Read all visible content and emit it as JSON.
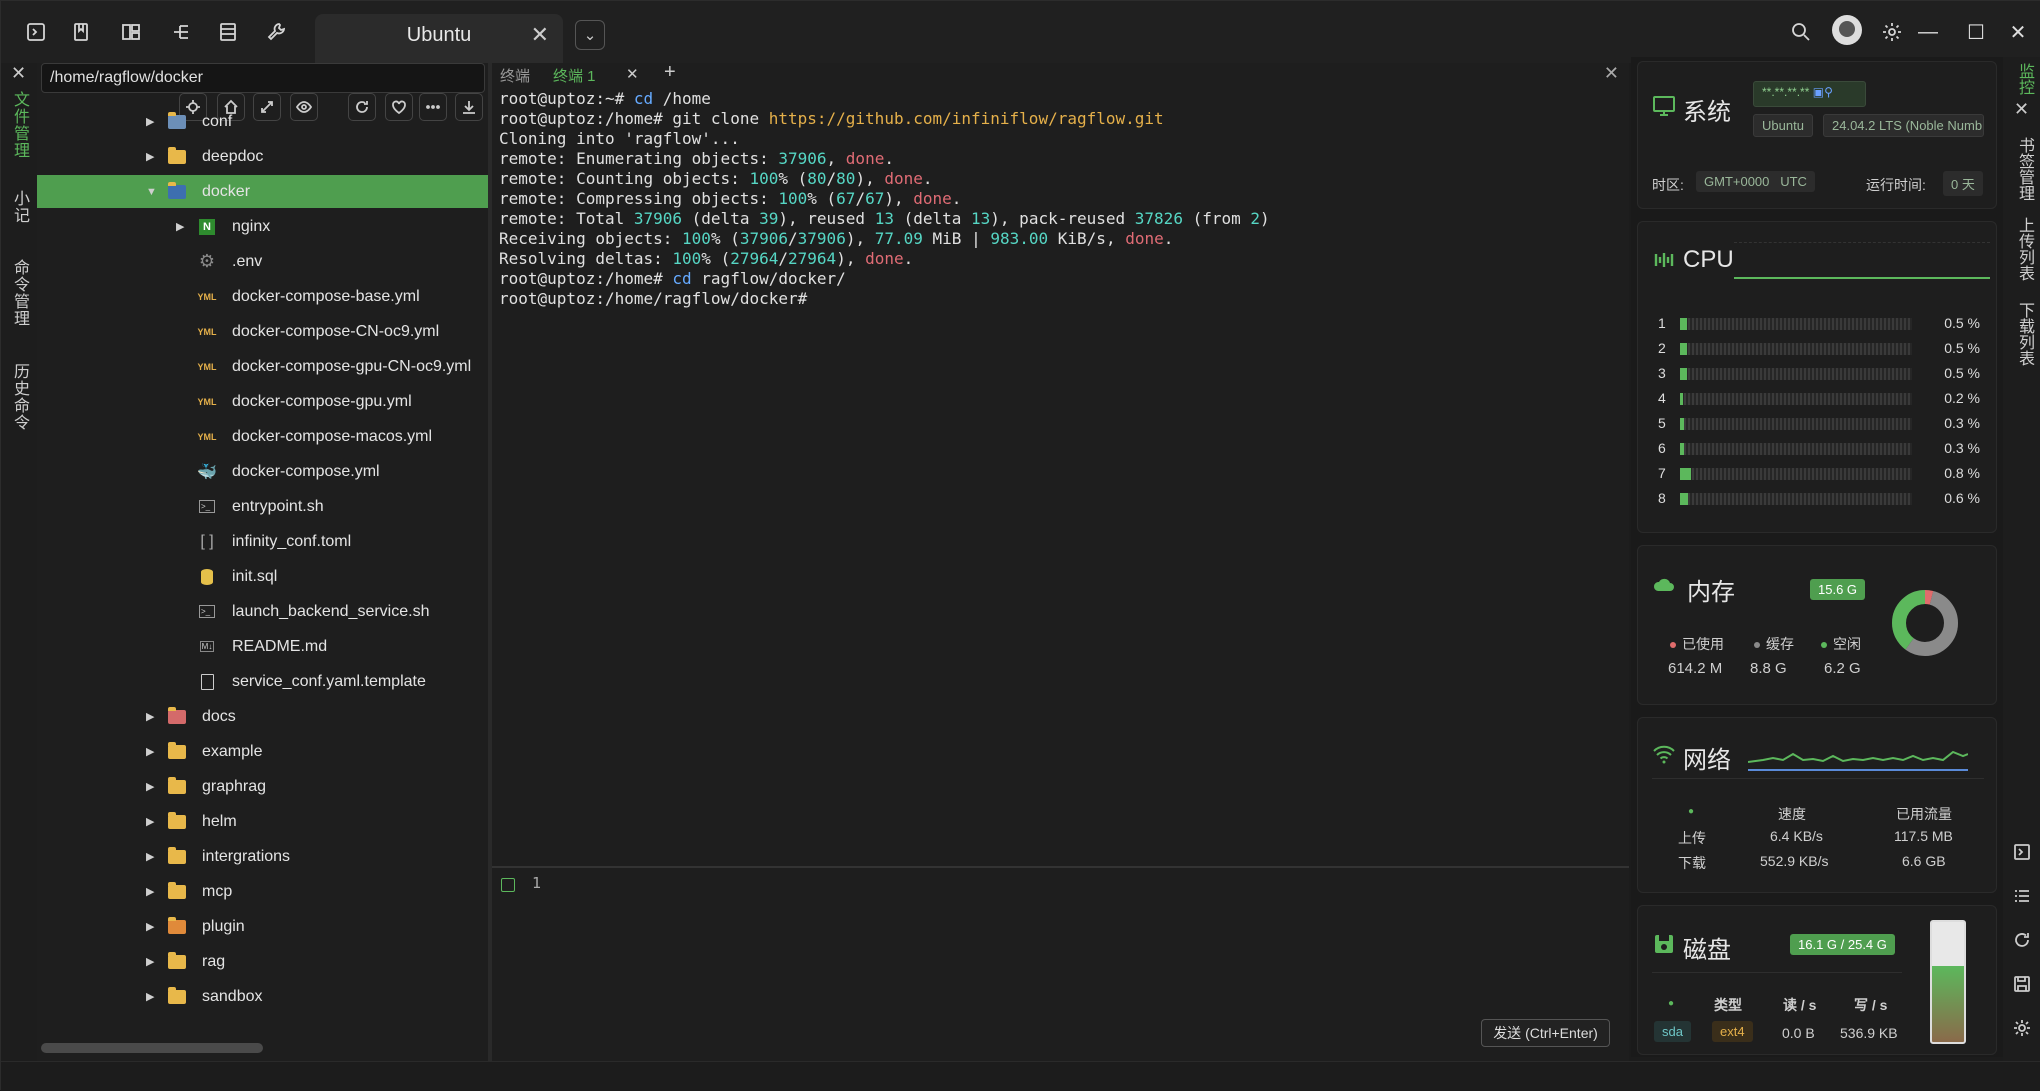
{
  "colors": {
    "accent": "#5cb85c",
    "selection": "#4f9e4f",
    "background": "#1e1e1e"
  },
  "titlebar": {
    "tab_title": "Ubuntu",
    "tab_close": "✕",
    "dropdown_glyph": "⌄",
    "min": "—",
    "max": "☐",
    "close": "✕"
  },
  "leftbar": {
    "close": "✕",
    "tabs": [
      "文件管理",
      "小记",
      "命令管理",
      "历史命令"
    ]
  },
  "filepanel": {
    "path": "/home/ragflow/docker",
    "tree": [
      {
        "label": "conf",
        "type": "folder-special",
        "expandable": true,
        "indent": 1
      },
      {
        "label": "deepdoc",
        "type": "folder",
        "expandable": true,
        "indent": 1
      },
      {
        "label": "docker",
        "type": "folder-open",
        "expandable": true,
        "expanded": true,
        "indent": 1,
        "selected": true
      },
      {
        "label": "nginx",
        "type": "nginx",
        "expandable": true,
        "indent": 2
      },
      {
        "label": ".env",
        "type": "gear",
        "indent": 2
      },
      {
        "label": "docker-compose-base.yml",
        "type": "yml",
        "indent": 2
      },
      {
        "label": "docker-compose-CN-oc9.yml",
        "type": "yml",
        "indent": 2
      },
      {
        "label": "docker-compose-gpu-CN-oc9.yml",
        "type": "yml",
        "indent": 2
      },
      {
        "label": "docker-compose-gpu.yml",
        "type": "yml",
        "indent": 2
      },
      {
        "label": "docker-compose-macos.yml",
        "type": "yml",
        "indent": 2
      },
      {
        "label": "docker-compose.yml",
        "type": "docker",
        "indent": 2
      },
      {
        "label": "entrypoint.sh",
        "type": "sh",
        "indent": 2
      },
      {
        "label": "infinity_conf.toml",
        "type": "toml",
        "indent": 2
      },
      {
        "label": "init.sql",
        "type": "sql",
        "indent": 2
      },
      {
        "label": "launch_backend_service.sh",
        "type": "sh",
        "indent": 2
      },
      {
        "label": "README.md",
        "type": "md",
        "indent": 2
      },
      {
        "label": "service_conf.yaml.template",
        "type": "file",
        "indent": 2
      },
      {
        "label": "docs",
        "type": "folder-red",
        "expandable": true,
        "indent": 1
      },
      {
        "label": "example",
        "type": "folder",
        "expandable": true,
        "indent": 1
      },
      {
        "label": "graphrag",
        "type": "folder",
        "expandable": true,
        "indent": 1
      },
      {
        "label": "helm",
        "type": "folder",
        "expandable": true,
        "indent": 1
      },
      {
        "label": "intergrations",
        "type": "folder",
        "expandable": true,
        "indent": 1
      },
      {
        "label": "mcp",
        "type": "folder",
        "expandable": true,
        "indent": 1
      },
      {
        "label": "plugin",
        "type": "folder-plugin",
        "expandable": true,
        "indent": 1
      },
      {
        "label": "rag",
        "type": "folder",
        "expandable": true,
        "indent": 1
      },
      {
        "label": "sandbox",
        "type": "folder",
        "expandable": true,
        "indent": 1
      }
    ]
  },
  "terminal": {
    "tabs": [
      {
        "label": "终端",
        "active": false
      },
      {
        "label": "终端  1",
        "active": true
      }
    ],
    "tab_close": "✕",
    "add": "+",
    "panel_close": "✕",
    "lines": [
      [
        {
          "t": "root@uptoz:~# "
        },
        {
          "t": "cd",
          "c": "cmd"
        },
        {
          "t": " /home"
        }
      ],
      [
        {
          "t": "root@uptoz:/home# git clone "
        },
        {
          "t": "https://github.com/infiniflow/ragflow.git",
          "c": "url"
        }
      ],
      [
        {
          "t": "Cloning into 'ragflow'..."
        }
      ],
      [
        {
          "t": "remote: Enumerating objects: "
        },
        {
          "t": "37906",
          "c": "num"
        },
        {
          "t": ", "
        },
        {
          "t": "done",
          "c": "done"
        },
        {
          "t": "."
        }
      ],
      [
        {
          "t": "remote: Counting objects: "
        },
        {
          "t": "100",
          "c": "num"
        },
        {
          "t": "% ("
        },
        {
          "t": "80",
          "c": "num"
        },
        {
          "t": "/"
        },
        {
          "t": "80",
          "c": "num"
        },
        {
          "t": "), "
        },
        {
          "t": "done",
          "c": "done"
        },
        {
          "t": "."
        }
      ],
      [
        {
          "t": "remote: Compressing objects: "
        },
        {
          "t": "100",
          "c": "num"
        },
        {
          "t": "% ("
        },
        {
          "t": "67",
          "c": "num"
        },
        {
          "t": "/"
        },
        {
          "t": "67",
          "c": "num"
        },
        {
          "t": "), "
        },
        {
          "t": "done",
          "c": "done"
        },
        {
          "t": "."
        }
      ],
      [
        {
          "t": "remote: Total "
        },
        {
          "t": "37906",
          "c": "num"
        },
        {
          "t": " (delta "
        },
        {
          "t": "39",
          "c": "num"
        },
        {
          "t": "), reused "
        },
        {
          "t": "13",
          "c": "num"
        },
        {
          "t": " (delta "
        },
        {
          "t": "13",
          "c": "num"
        },
        {
          "t": "), pack-reused "
        },
        {
          "t": "37826",
          "c": "num"
        },
        {
          "t": " (from "
        },
        {
          "t": "2",
          "c": "num"
        },
        {
          "t": ")"
        }
      ],
      [
        {
          "t": "Receiving objects: "
        },
        {
          "t": "100",
          "c": "num"
        },
        {
          "t": "% ("
        },
        {
          "t": "37906",
          "c": "num"
        },
        {
          "t": "/"
        },
        {
          "t": "37906",
          "c": "num"
        },
        {
          "t": "), "
        },
        {
          "t": "77.09",
          "c": "num"
        },
        {
          "t": " MiB | "
        },
        {
          "t": "983.00",
          "c": "num"
        },
        {
          "t": " KiB/s, "
        },
        {
          "t": "done",
          "c": "done"
        },
        {
          "t": "."
        }
      ],
      [
        {
          "t": "Resolving deltas: "
        },
        {
          "t": "100",
          "c": "num"
        },
        {
          "t": "% ("
        },
        {
          "t": "27964",
          "c": "num"
        },
        {
          "t": "/"
        },
        {
          "t": "27964",
          "c": "num"
        },
        {
          "t": "), "
        },
        {
          "t": "done",
          "c": "done"
        },
        {
          "t": "."
        }
      ],
      [
        {
          "t": "root@uptoz:/home# "
        },
        {
          "t": "cd",
          "c": "cmd"
        },
        {
          "t": " ragflow/docker/"
        }
      ],
      [
        {
          "t": "root@uptoz:/home/ragflow/docker# "
        }
      ]
    ],
    "input_line_number": "1",
    "send_button": "发送 (Ctrl+Enter)"
  },
  "monitor": {
    "system": {
      "title": "系统",
      "ip": "**.**.**.**",
      "os": "Ubuntu",
      "version": "24.04.2 LTS (Noble Numb",
      "tz_label": "时区:",
      "tz_value": "GMT+0000   UTC",
      "uptime_label": "运行时间:",
      "uptime_value": "0 天"
    },
    "cpu": {
      "title": "CPU",
      "cores": [
        {
          "n": "1",
          "v": "0.5 %",
          "p": 0.005
        },
        {
          "n": "2",
          "v": "0.5 %",
          "p": 0.005
        },
        {
          "n": "3",
          "v": "0.5 %",
          "p": 0.005
        },
        {
          "n": "4",
          "v": "0.2 %",
          "p": 0.002
        },
        {
          "n": "5",
          "v": "0.3 %",
          "p": 0.003
        },
        {
          "n": "6",
          "v": "0.3 %",
          "p": 0.003
        },
        {
          "n": "7",
          "v": "0.8 %",
          "p": 0.008
        },
        {
          "n": "8",
          "v": "0.6 %",
          "p": 0.006
        }
      ]
    },
    "memory": {
      "title": "内存",
      "total": "15.6 G",
      "used_label": "已使用",
      "used": "614.2 M",
      "cache_label": "缓存",
      "cache": "8.8 G",
      "free_label": "空闲",
      "free": "6.2 G",
      "used_color": "#e06c6c",
      "cache_color": "#8a8a8a",
      "free_color": "#5cb85c",
      "used_frac": 0.04,
      "cache_frac": 0.56,
      "free_frac": 0.4
    },
    "network": {
      "title": "网络",
      "speed_label": "速度",
      "traffic_label": "已用流量",
      "up_label": "上传",
      "up_speed": "6.4 KB/s",
      "up_total": "117.5 MB",
      "down_label": "下载",
      "down_speed": "552.9 KB/s",
      "down_total": "6.6 GB"
    },
    "disk": {
      "title": "磁盘",
      "usage": "16.1 G / 25.4 G",
      "type_label": "类型",
      "read_label": "读 / s",
      "write_label": "写 / s",
      "dev": "sda",
      "fs": "ext4",
      "read": "0.0 B",
      "write": "536.9 KB",
      "fill_frac": 0.634
    }
  },
  "rightbar": {
    "close": "✕",
    "tabs": [
      "监控",
      "书签管理",
      "上传列表",
      "下载列表"
    ]
  }
}
